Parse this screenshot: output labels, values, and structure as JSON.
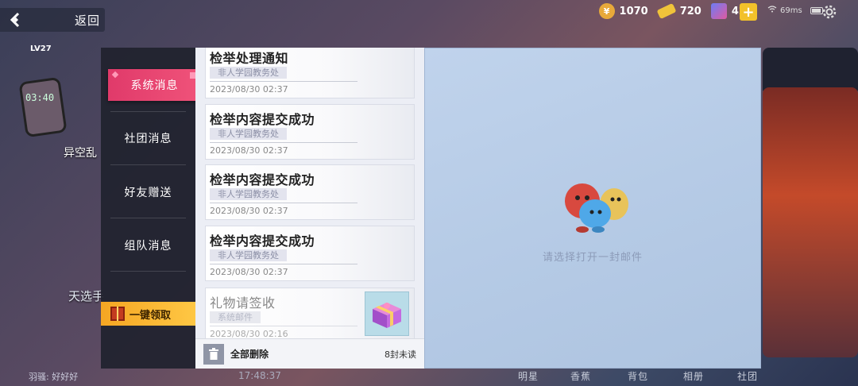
{
  "topbar": {
    "back_label": "返回",
    "coins": "1070",
    "tickets": "720",
    "gems": "428",
    "signal": "69ms"
  },
  "background": {
    "level": "LV27",
    "clock": "03:40",
    "label_1": "异空乱",
    "label_2": "天选手",
    "timer": "17:48:37",
    "user_label": "羽骚: 好好好",
    "nav": [
      "明星",
      "香蕉",
      "背包",
      "相册",
      "社团"
    ]
  },
  "tabs": [
    {
      "label": "系统消息",
      "active": true
    },
    {
      "label": "社团消息",
      "active": false
    },
    {
      "label": "好友赠送",
      "active": false
    },
    {
      "label": "组队消息",
      "active": false
    }
  ],
  "claim_all_label": "一键领取",
  "mails": [
    {
      "title": "检举处理通知",
      "sender": "非人学园教务处",
      "time": "2023/08/30 02:37",
      "read": false
    },
    {
      "title": "检举内容提交成功",
      "sender": "非人学园教务处",
      "time": "2023/08/30 02:37",
      "read": false
    },
    {
      "title": "检举内容提交成功",
      "sender": "非人学园教务处",
      "time": "2023/08/30 02:37",
      "read": false
    },
    {
      "title": "检举内容提交成功",
      "sender": "非人学园教务处",
      "time": "2023/08/30 02:37",
      "read": false
    },
    {
      "title": "礼物请签收",
      "sender": "系统邮件",
      "time": "2023/08/30 02:16",
      "read": true
    }
  ],
  "footer": {
    "delete_all_label": "全部删除",
    "unread_count": "8封未读"
  },
  "detail": {
    "empty_hint": "请选择打开一封邮件"
  },
  "colors": {
    "active_tab": "#e03a6a",
    "claim_button": "#f5a623",
    "detail_bg": "#b6cbe6"
  }
}
